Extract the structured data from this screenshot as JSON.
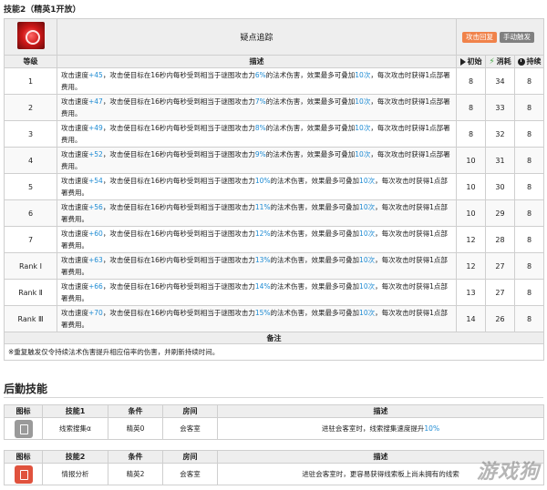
{
  "section_title": "技能2（精英1开放）",
  "skill": {
    "name": "疑点追踪",
    "badges": [
      "攻击回复",
      "手动触发"
    ],
    "icon": "crimson-seal-icon",
    "headers": {
      "level": "等级",
      "desc": "描述",
      "init": "初始",
      "cost": "消耗",
      "duration": "持续"
    },
    "levels": [
      {
        "level": "1",
        "pre": "攻击速度",
        "speed": "+45",
        "mid1": "，攻击使目标在16秒内每秒受到相当于谜图攻击力",
        "pct": "6%",
        "mid2": "的法术伤害，效果最多可叠加",
        "stack": "10次",
        "post": "，每次攻击时获得1点部署费用。",
        "init": "8",
        "cost": "34",
        "duration": "8"
      },
      {
        "level": "2",
        "pre": "攻击速度",
        "speed": "+47",
        "mid1": "，攻击使目标在16秒内每秒受到相当于谜图攻击力",
        "pct": "7%",
        "mid2": "的法术伤害，效果最多可叠加",
        "stack": "10次",
        "post": "，每次攻击时获得1点部署费用。",
        "init": "8",
        "cost": "33",
        "duration": "8"
      },
      {
        "level": "3",
        "pre": "攻击速度",
        "speed": "+49",
        "mid1": "，攻击使目标在16秒内每秒受到相当于谜图攻击力",
        "pct": "8%",
        "mid2": "的法术伤害，效果最多可叠加",
        "stack": "10次",
        "post": "，每次攻击时获得1点部署费用。",
        "init": "8",
        "cost": "32",
        "duration": "8"
      },
      {
        "level": "4",
        "pre": "攻击速度",
        "speed": "+52",
        "mid1": "，攻击使目标在16秒内每秒受到相当于谜图攻击力",
        "pct": "9%",
        "mid2": "的法术伤害，效果最多可叠加",
        "stack": "10次",
        "post": "，每次攻击时获得1点部署费用。",
        "init": "10",
        "cost": "31",
        "duration": "8"
      },
      {
        "level": "5",
        "pre": "攻击速度",
        "speed": "+54",
        "mid1": "，攻击使目标在16秒内每秒受到相当于谜图攻击力",
        "pct": "10%",
        "mid2": "的法术伤害，效果最多可叠加",
        "stack": "10次",
        "post": "，每次攻击时获得1点部署费用。",
        "init": "10",
        "cost": "30",
        "duration": "8"
      },
      {
        "level": "6",
        "pre": "攻击速度",
        "speed": "+56",
        "mid1": "，攻击使目标在16秒内每秒受到相当于谜图攻击力",
        "pct": "11%",
        "mid2": "的法术伤害，效果最多可叠加",
        "stack": "10次",
        "post": "，每次攻击时获得1点部署费用。",
        "init": "10",
        "cost": "29",
        "duration": "8"
      },
      {
        "level": "7",
        "pre": "攻击速度",
        "speed": "+60",
        "mid1": "，攻击使目标在16秒内每秒受到相当于谜图攻击力",
        "pct": "12%",
        "mid2": "的法术伤害，效果最多可叠加",
        "stack": "10次",
        "post": "，每次攻击时获得1点部署费用。",
        "init": "12",
        "cost": "28",
        "duration": "8"
      },
      {
        "level": "Rank Ⅰ",
        "pre": "攻击速度",
        "speed": "+63",
        "mid1": "，攻击使目标在16秒内每秒受到相当于谜图攻击力",
        "pct": "13%",
        "mid2": "的法术伤害，效果最多可叠加",
        "stack": "10次",
        "post": "，每次攻击时获得1点部署费用。",
        "init": "12",
        "cost": "27",
        "duration": "8"
      },
      {
        "level": "Rank Ⅱ",
        "pre": "攻击速度",
        "speed": "+66",
        "mid1": "，攻击使目标在16秒内每秒受到相当于谜图攻击力",
        "pct": "14%",
        "mid2": "的法术伤害，效果最多可叠加",
        "stack": "10次",
        "post": "，每次攻击时获得1点部署费用。",
        "init": "13",
        "cost": "27",
        "duration": "8"
      },
      {
        "level": "Rank Ⅲ",
        "pre": "攻击速度",
        "speed": "+70",
        "mid1": "，攻击使目标在16秒内每秒受到相当于谜图攻击力",
        "pct": "15%",
        "mid2": "的法术伤害，效果最多可叠加",
        "stack": "10次",
        "post": "，每次攻击时获得1点部署费用。",
        "init": "14",
        "cost": "26",
        "duration": "8"
      }
    ],
    "note_header": "备注",
    "note": "※重复触发仅令持续法术伤害提升相应倍率的伤害，并刷新持续时间。"
  },
  "base": {
    "title": "后勤技能",
    "table1": {
      "headers": {
        "icon": "图标",
        "skill": "技能1",
        "cond": "条件",
        "room": "房间",
        "desc": "描述"
      },
      "row": {
        "icon": "clue-search-icon",
        "name": "线索搜集α",
        "cond": "精英0",
        "room": "会客室",
        "desc_pre": "进驻会客室时，线索搜集速度提升",
        "desc_val": "10%"
      }
    },
    "table2": {
      "headers": {
        "icon": "图标",
        "skill": "技能2",
        "cond": "条件",
        "room": "房间",
        "desc": "描述"
      },
      "row": {
        "icon": "intel-analysis-icon",
        "name": "情报分析",
        "cond": "精英2",
        "room": "会客室",
        "desc": "进驻会客室时，更容易获得线索板上尚未拥有的线索"
      }
    }
  },
  "colors": {
    "highlight": "#1e8bd3",
    "badge_orange": "#f0824a",
    "badge_gray": "#808080",
    "header_bg": "#eeeeee"
  }
}
